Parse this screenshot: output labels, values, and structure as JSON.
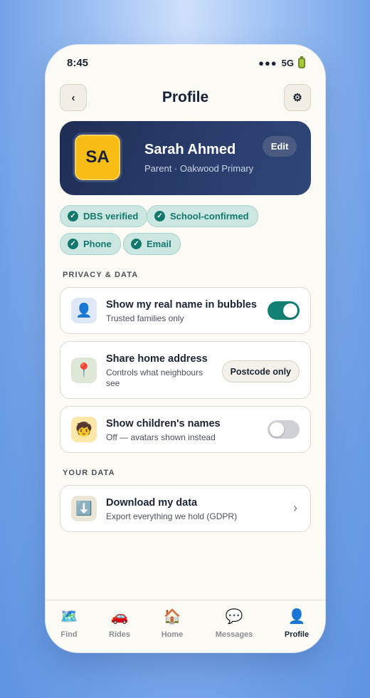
{
  "status_bar": {
    "time": "8:45",
    "signal": "●●●",
    "network": "5G"
  },
  "header": {
    "title": "Profile",
    "back_icon": "‹",
    "settings_icon": "⚙"
  },
  "profile": {
    "initials": "SA",
    "name": "Sarah Ahmed",
    "role": "Parent · Oakwood Primary",
    "edit_label": "Edit"
  },
  "badges": [
    "DBS verified",
    "School-confirmed",
    "Phone",
    "Email"
  ],
  "privacy": {
    "section_label": "PRIVACY & DATA",
    "real_name": {
      "title": "Show my real name in bubbles",
      "subtitle": "Trusted families only",
      "enabled": true,
      "icon": "👤"
    },
    "address": {
      "title": "Share home address",
      "subtitle": "Controls what neighbours see",
      "value": "Postcode only",
      "icon": "📍"
    },
    "children": {
      "title": "Show children's names",
      "subtitle": "Off — avatars shown instead",
      "enabled": false,
      "icon": "🧒"
    }
  },
  "your_data": {
    "section_label": "YOUR DATA",
    "download": {
      "title": "Download my data",
      "subtitle": "Export everything we hold (GDPR)",
      "icon": "⬇️"
    }
  },
  "nav": {
    "items": [
      {
        "label": "Find",
        "icon": "🗺️"
      },
      {
        "label": "Rides",
        "icon": "🚗"
      },
      {
        "label": "Home",
        "icon": "🏠"
      },
      {
        "label": "Messages",
        "icon": "💬"
      },
      {
        "label": "Profile",
        "icon": "👤"
      }
    ],
    "active": "Profile"
  },
  "colors": {
    "accent": "#128074",
    "card": "#23345f",
    "avatar": "#f7bd14",
    "chip_bg": "#cce6e2"
  }
}
